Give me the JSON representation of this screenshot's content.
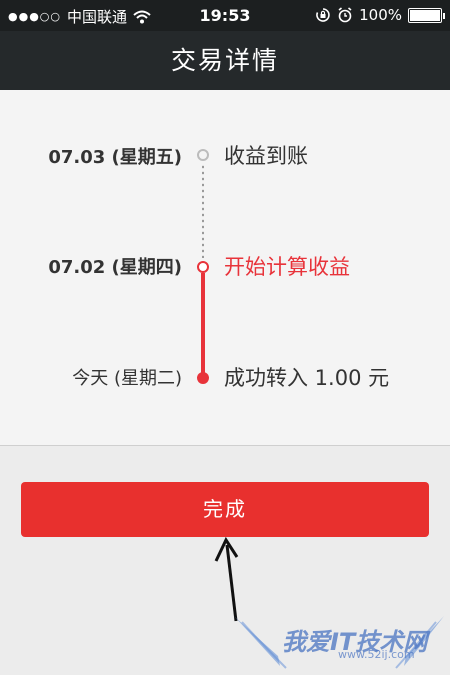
{
  "status_bar": {
    "signal": "●●●○○",
    "carrier": "中国联通",
    "time": "19:53",
    "battery_text": "100%",
    "battery_level": 1.0,
    "icons": [
      "signal-icon",
      "wifi-icon",
      "rotation-lock-icon",
      "alarm-icon",
      "battery-icon"
    ]
  },
  "nav": {
    "title": "交易详情"
  },
  "timeline": [
    {
      "date": "07.03 (星期五)",
      "event": "收益到账",
      "state": "pending"
    },
    {
      "date": "07.02 (星期四)",
      "event": "开始计算收益",
      "state": "current"
    },
    {
      "date": "今天 (星期二)",
      "event": "成功转入 1.00 元",
      "state": "done"
    }
  ],
  "colors": {
    "accent": "#e8333a",
    "navbar": "#25292b",
    "statusbar": "#1c1f20"
  },
  "action": {
    "done_label": "完成"
  },
  "watermark": {
    "text": "我爱IT技术网",
    "sub": "www.52ij.com"
  }
}
